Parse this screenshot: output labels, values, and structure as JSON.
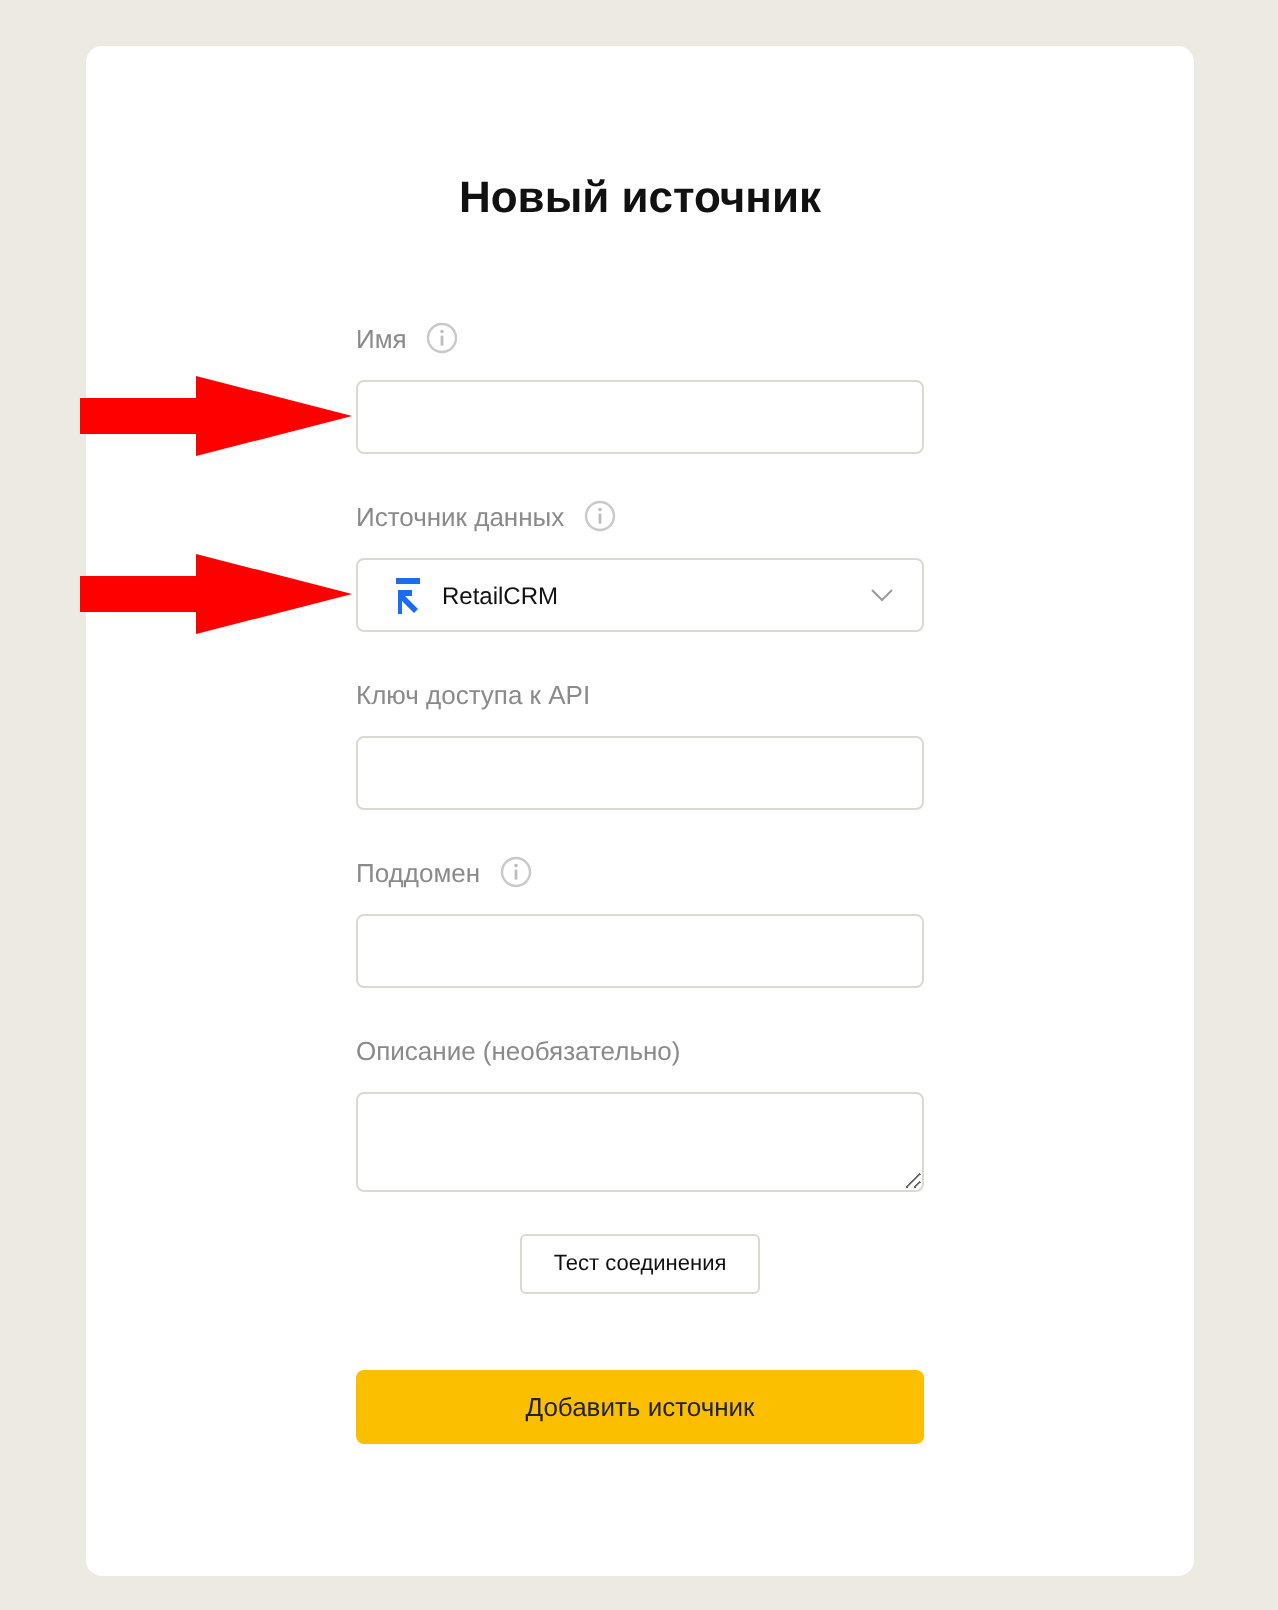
{
  "title": "Новый источник",
  "fields": [
    {
      "kind": "text",
      "label": "Имя",
      "info": true,
      "arrow": true
    },
    {
      "kind": "select",
      "label": "Источник данных",
      "info": true,
      "arrow": true,
      "value": "RetailCRM"
    },
    {
      "kind": "text",
      "label": "Ключ доступа к API",
      "info": false,
      "arrow": false
    },
    {
      "kind": "text",
      "label": "Поддомен",
      "info": true,
      "arrow": false
    },
    {
      "kind": "textarea",
      "label": "Описание (необязательно)",
      "info": false,
      "arrow": false
    }
  ],
  "test_button": "Тест соединения",
  "submit_button": "Добавить источник"
}
